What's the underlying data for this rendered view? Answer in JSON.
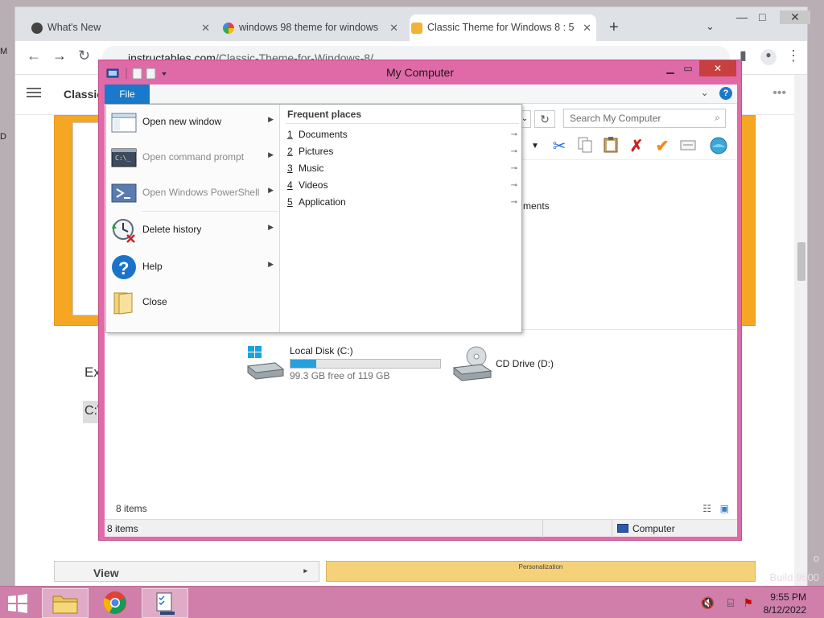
{
  "desktop": {
    "left_fragments": [
      "M",
      "D"
    ],
    "watermark_lines": [
      "o",
      "Build 9600"
    ]
  },
  "browser": {
    "tabs": [
      {
        "label": "What's New",
        "active": false
      },
      {
        "label": "windows 98 theme for windows",
        "active": false
      },
      {
        "label": "Classic Theme for Windows 8 : 5",
        "active": true
      }
    ],
    "new_tab_label": "+",
    "url_host": "instructables.com",
    "url_path": "/Classic-Theme-for-Windows-8/",
    "site_title": "Classic",
    "body_text_fragment": "Ex",
    "code_fragment": "C:\\",
    "card_view_label": "View",
    "card_personalization_label": "Personalization"
  },
  "explorer": {
    "title": "My Computer",
    "file_tab_label": "File",
    "search_placeholder": "Search My Computer",
    "background_text_fragment": "ments",
    "drives": [
      {
        "name": "Local Disk (C:)",
        "free_text": "99.3 GB free of 119 GB",
        "used_fraction": 0.17
      },
      {
        "name": "CD Drive (D:)"
      }
    ],
    "footer_items_count": "8 items",
    "status_items_count": "8 items",
    "status_location": "Computer"
  },
  "file_menu": {
    "commands": [
      {
        "label": "Open new window",
        "underline": "n",
        "enabled": true,
        "has_submenu": true,
        "icon": "window-icon"
      },
      {
        "label": "Open command prompt",
        "underline": "p",
        "enabled": false,
        "has_submenu": true,
        "icon": "command-prompt-icon"
      },
      {
        "label": "Open Windows PowerShell",
        "underline": "r",
        "enabled": false,
        "has_submenu": true,
        "icon": "powershell-icon"
      },
      {
        "label": "Delete history",
        "underline": "D",
        "enabled": true,
        "has_submenu": true,
        "icon": "delete-history-icon"
      },
      {
        "label": "Help",
        "underline": "H",
        "enabled": true,
        "has_submenu": true,
        "icon": "help-icon"
      },
      {
        "label": "Close",
        "underline": "C",
        "enabled": true,
        "has_submenu": false,
        "icon": "close-folder-icon"
      }
    ],
    "frequent_places_title": "Frequent places",
    "frequent_places": [
      {
        "num": "1",
        "label": "Documents"
      },
      {
        "num": "2",
        "label": "Pictures"
      },
      {
        "num": "3",
        "label": "Music"
      },
      {
        "num": "4",
        "label": "Videos"
      },
      {
        "num": "5",
        "label": "Application"
      }
    ]
  },
  "taskbar": {
    "time": "9:55 PM",
    "date": "8/12/2022"
  },
  "colors": {
    "window_frame": "#e06aa7",
    "taskbar": "#cf7fa9",
    "accent": "#1979ca",
    "close_button": "#c7403f",
    "drive_fill": "#26a0da"
  }
}
